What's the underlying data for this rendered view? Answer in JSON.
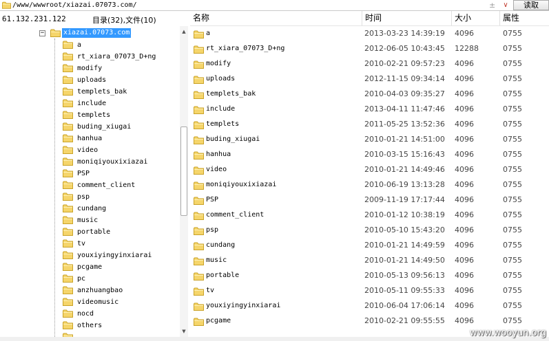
{
  "address": {
    "path": "/www/wwwroot/xiazai.07073.com/",
    "star": "±",
    "dropdown": "∨",
    "read_label": "读取"
  },
  "left": {
    "ip": "61.132.231.122",
    "counts": "目录(32),文件(10)",
    "expander": "−",
    "root": "xiazai.07073.com",
    "items": [
      "a",
      "rt_xiara_07073_D+ng",
      "modify",
      "uploads",
      "templets_bak",
      "include",
      "templets",
      "buding_xiugai",
      "hanhua",
      "video",
      "moniqiyouxixiazai",
      "PSP",
      "comment_client",
      "psp",
      "cundang",
      "music",
      "portable",
      "tv",
      "youxiyingyinxiarai",
      "pcgame",
      "pc",
      "anzhuangbao",
      "videomusic",
      "nocd",
      "others",
      "..."
    ]
  },
  "columns": {
    "name": "名称",
    "time": "时间",
    "size": "大小",
    "attr": "属性"
  },
  "files": [
    {
      "name": "a",
      "time": "2013-03-23 14:39:19",
      "size": "4096",
      "attr": "0755"
    },
    {
      "name": "rt_xiara_07073_D+ng",
      "time": "2012-06-05 10:43:45",
      "size": "12288",
      "attr": "0755"
    },
    {
      "name": "modify",
      "time": "2010-02-21 09:57:23",
      "size": "4096",
      "attr": "0755"
    },
    {
      "name": "uploads",
      "time": "2012-11-15 09:34:14",
      "size": "4096",
      "attr": "0755"
    },
    {
      "name": "templets_bak",
      "time": "2010-04-03 09:35:27",
      "size": "4096",
      "attr": "0755"
    },
    {
      "name": "include",
      "time": "2013-04-11 11:47:46",
      "size": "4096",
      "attr": "0755"
    },
    {
      "name": "templets",
      "time": "2011-05-25 13:52:36",
      "size": "4096",
      "attr": "0755"
    },
    {
      "name": "buding_xiugai",
      "time": "2010-01-21 14:51:00",
      "size": "4096",
      "attr": "0755"
    },
    {
      "name": "hanhua",
      "time": "2010-03-15 15:16:43",
      "size": "4096",
      "attr": "0755"
    },
    {
      "name": "video",
      "time": "2010-01-21 14:49:46",
      "size": "4096",
      "attr": "0755"
    },
    {
      "name": "moniqiyouxixiazai",
      "time": "2010-06-19 13:13:28",
      "size": "4096",
      "attr": "0755"
    },
    {
      "name": "PSP",
      "time": "2009-11-19 17:17:44",
      "size": "4096",
      "attr": "0755"
    },
    {
      "name": "comment_client",
      "time": "2010-01-12 10:38:19",
      "size": "4096",
      "attr": "0755"
    },
    {
      "name": "psp",
      "time": "2010-05-10 15:43:20",
      "size": "4096",
      "attr": "0755"
    },
    {
      "name": "cundang",
      "time": "2010-01-21 14:49:59",
      "size": "4096",
      "attr": "0755"
    },
    {
      "name": "music",
      "time": "2010-01-21 14:49:50",
      "size": "4096",
      "attr": "0755"
    },
    {
      "name": "portable",
      "time": "2010-05-13 09:56:13",
      "size": "4096",
      "attr": "0755"
    },
    {
      "name": "tv",
      "time": "2010-05-11 09:55:33",
      "size": "4096",
      "attr": "0755"
    },
    {
      "name": "youxiyingyinxiarai",
      "time": "2010-06-04 17:06:14",
      "size": "4096",
      "attr": "0755"
    },
    {
      "name": "pcgame",
      "time": "2010-02-21 09:55:55",
      "size": "4096",
      "attr": "0755"
    }
  ],
  "scroll": {
    "up": "▲",
    "down": "▼"
  },
  "watermark": "www.wooyun.org",
  "colors": {
    "folder": "#f5d56b",
    "folder_edge": "#c9a227",
    "selection": "#3399ff"
  }
}
